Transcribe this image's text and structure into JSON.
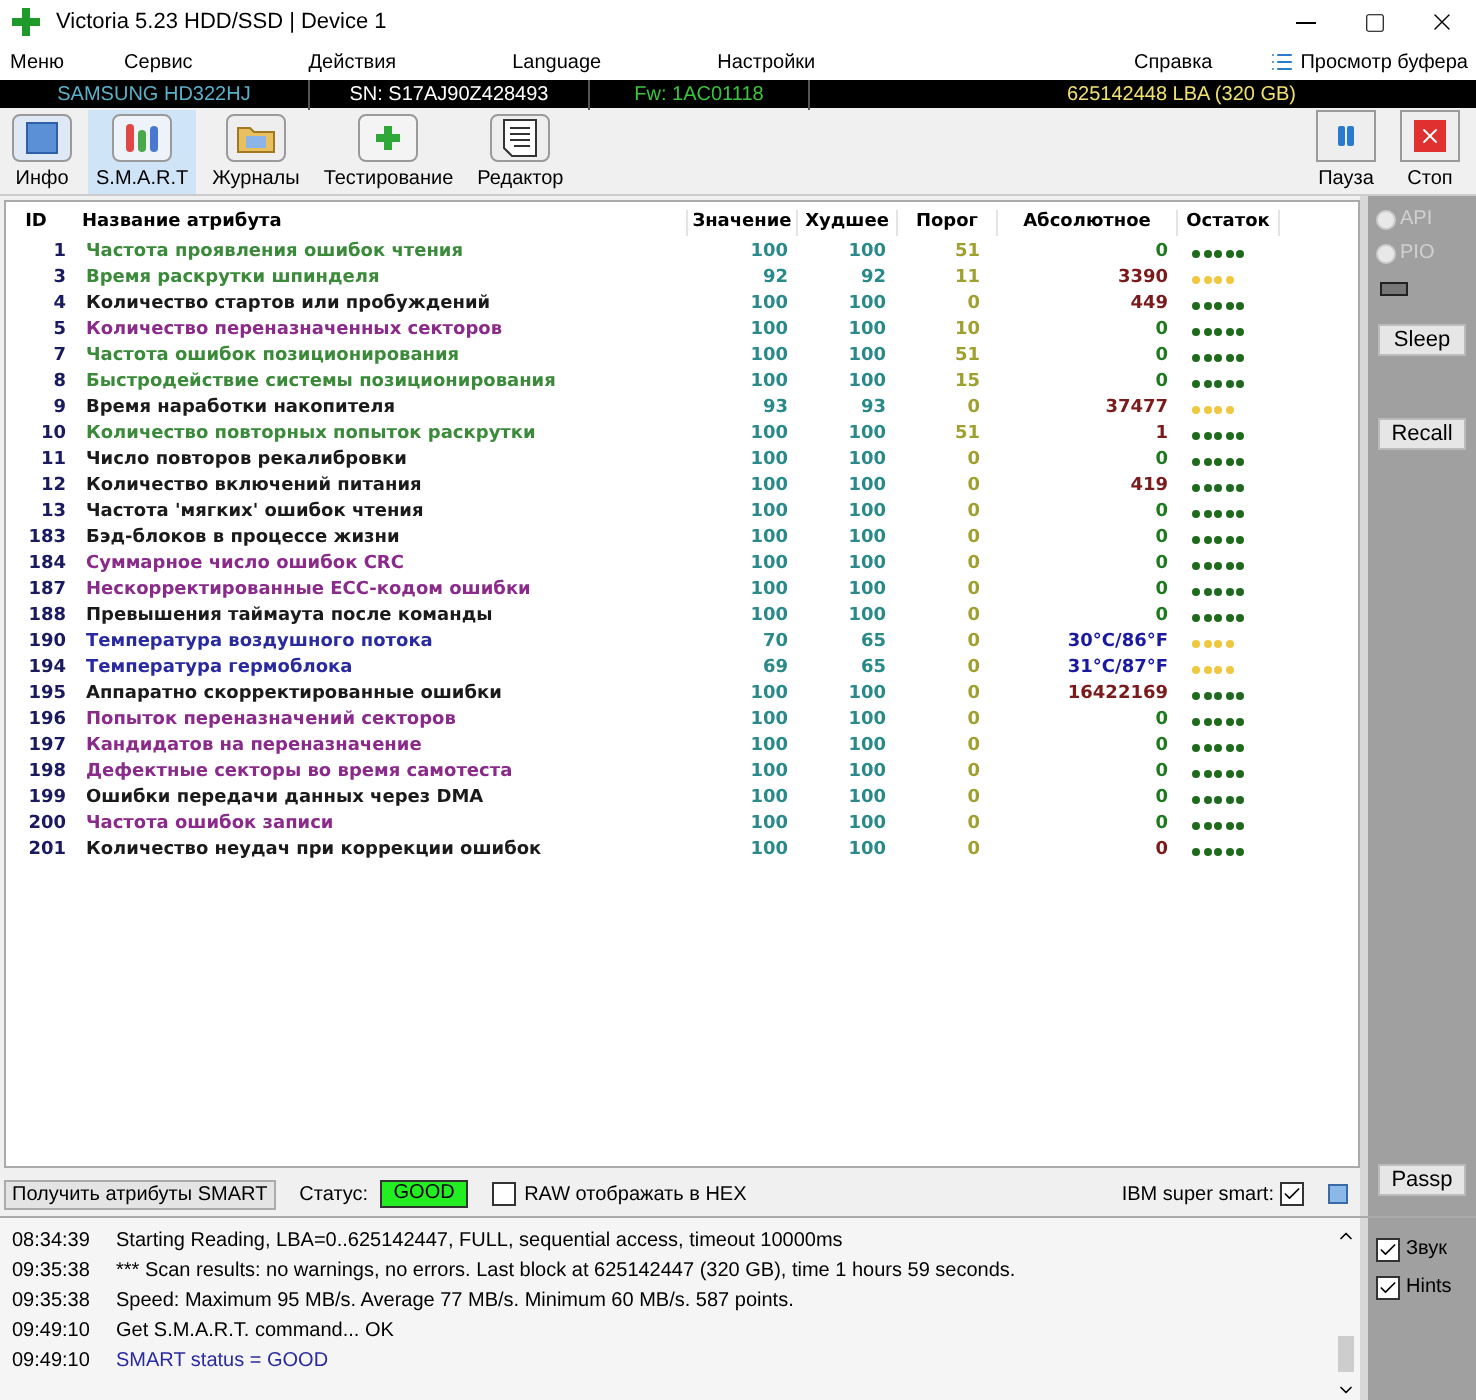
{
  "window": {
    "title": "Victoria 5.23 HDD/SSD | Device 1"
  },
  "menu": [
    "Меню",
    "Сервис",
    "Действия",
    "Language",
    "Настройки",
    "Справка"
  ],
  "buffer_button": "Просмотр буфера",
  "info_bar": {
    "model": "SAMSUNG HD322HJ",
    "serial": "SN: S17AJ90Z428493",
    "firmware": "Fw: 1AC01118",
    "capacity": "625142448 LBA (320 GB)"
  },
  "toolbar": [
    {
      "kind": "info",
      "label": "Инфо",
      "selected": false
    },
    {
      "kind": "smart",
      "label": "S.M.A.R.T",
      "selected": true
    },
    {
      "kind": "logs",
      "label": "Журналы",
      "selected": false
    },
    {
      "kind": "test",
      "label": "Тестирование",
      "selected": false
    },
    {
      "kind": "editor",
      "label": "Редактор",
      "selected": false
    }
  ],
  "toolbar_right": [
    {
      "kind": "pause",
      "label": "Пауза"
    },
    {
      "kind": "stop",
      "label": "Стоп"
    }
  ],
  "table": {
    "columns": [
      "ID",
      "Название атрибута",
      "Значение",
      "Худшее",
      "Порог",
      "Абсолютное",
      "Остаток"
    ],
    "rows": [
      {
        "id": "1",
        "name": "Частота проявления ошибок чтения",
        "color": "#3a8a3a",
        "value": "100",
        "worst": "100",
        "threshold": "51",
        "raw": "0",
        "kind": "zero",
        "stars": 5
      },
      {
        "id": "3",
        "name": "Время раскрутки шпинделя",
        "color": "#3a8a3a",
        "value": "92",
        "worst": "92",
        "threshold": "11",
        "raw": "3390",
        "kind": "count",
        "stars": 4
      },
      {
        "id": "4",
        "name": "Количество стартов или пробуждений",
        "color": "#1a1a1a",
        "value": "100",
        "worst": "100",
        "threshold": "0",
        "raw": "449",
        "kind": "count",
        "stars": 5
      },
      {
        "id": "5",
        "name": "Количество переназначенных секторов",
        "color": "#8a2a8a",
        "value": "100",
        "worst": "100",
        "threshold": "10",
        "raw": "0",
        "kind": "zero",
        "stars": 5
      },
      {
        "id": "7",
        "name": "Частота ошибок позиционирования",
        "color": "#3a8a3a",
        "value": "100",
        "worst": "100",
        "threshold": "51",
        "raw": "0",
        "kind": "zero",
        "stars": 5
      },
      {
        "id": "8",
        "name": "Быстродействие системы позиционирования",
        "color": "#3a8a3a",
        "value": "100",
        "worst": "100",
        "threshold": "15",
        "raw": "0",
        "kind": "zero",
        "stars": 5
      },
      {
        "id": "9",
        "name": "Время наработки накопителя",
        "color": "#1a1a1a",
        "value": "93",
        "worst": "93",
        "threshold": "0",
        "raw": "37477",
        "kind": "count",
        "stars": 4
      },
      {
        "id": "10",
        "name": "Количество повторных попыток раскрутки",
        "color": "#3a8a3a",
        "value": "100",
        "worst": "100",
        "threshold": "51",
        "raw": "1",
        "kind": "count",
        "stars": 5
      },
      {
        "id": "11",
        "name": "Число повторов рекалибровки",
        "color": "#1a1a1a",
        "value": "100",
        "worst": "100",
        "threshold": "0",
        "raw": "0",
        "kind": "zero",
        "stars": 5
      },
      {
        "id": "12",
        "name": "Количество включений питания",
        "color": "#1a1a1a",
        "value": "100",
        "worst": "100",
        "threshold": "0",
        "raw": "419",
        "kind": "count",
        "stars": 5
      },
      {
        "id": "13",
        "name": "Частота 'мягких' ошибок чтения",
        "color": "#1a1a1a",
        "value": "100",
        "worst": "100",
        "threshold": "0",
        "raw": "0",
        "kind": "zero",
        "stars": 5
      },
      {
        "id": "183",
        "name": "Бэд-блоков в процессе жизни",
        "color": "#1a1a1a",
        "value": "100",
        "worst": "100",
        "threshold": "0",
        "raw": "0",
        "kind": "zero",
        "stars": 5
      },
      {
        "id": "184",
        "name": "Суммарное число ошибок CRC",
        "color": "#8a2a8a",
        "value": "100",
        "worst": "100",
        "threshold": "0",
        "raw": "0",
        "kind": "zero",
        "stars": 5
      },
      {
        "id": "187",
        "name": "Нескорректированные ECC-кодом ошибки",
        "color": "#8a2a8a",
        "value": "100",
        "worst": "100",
        "threshold": "0",
        "raw": "0",
        "kind": "zero",
        "stars": 5
      },
      {
        "id": "188",
        "name": "Превышения таймаута после команды",
        "color": "#1a1a1a",
        "value": "100",
        "worst": "100",
        "threshold": "0",
        "raw": "0",
        "kind": "zero",
        "stars": 5
      },
      {
        "id": "190",
        "name": "Температура воздушного потока",
        "color": "#2a2aa0",
        "value": "70",
        "worst": "65",
        "threshold": "0",
        "raw": "30°C/86°F",
        "kind": "temperature",
        "stars": 4
      },
      {
        "id": "194",
        "name": "Температура гермоблока",
        "color": "#2a2aa0",
        "value": "69",
        "worst": "65",
        "threshold": "0",
        "raw": "31°C/87°F",
        "kind": "temperature",
        "stars": 4
      },
      {
        "id": "195",
        "name": "Аппаратно скорректированные ошибки",
        "color": "#1a1a1a",
        "value": "100",
        "worst": "100",
        "threshold": "0",
        "raw": "16422169",
        "kind": "count",
        "stars": 5
      },
      {
        "id": "196",
        "name": "Попыток переназначений секторов",
        "color": "#8a2a8a",
        "value": "100",
        "worst": "100",
        "threshold": "0",
        "raw": "0",
        "kind": "zero",
        "stars": 5
      },
      {
        "id": "197",
        "name": "Кандидатов на переназначение",
        "color": "#8a2a8a",
        "value": "100",
        "worst": "100",
        "threshold": "0",
        "raw": "0",
        "kind": "zero",
        "stars": 5
      },
      {
        "id": "198",
        "name": "Дефектные секторы во время самотеста",
        "color": "#8a2a8a",
        "value": "100",
        "worst": "100",
        "threshold": "0",
        "raw": "0",
        "kind": "zero",
        "stars": 5
      },
      {
        "id": "199",
        "name": "Ошибки передачи данных через DMA",
        "color": "#1a1a1a",
        "value": "100",
        "worst": "100",
        "threshold": "0",
        "raw": "0",
        "kind": "zero",
        "stars": 5
      },
      {
        "id": "200",
        "name": "Частота ошибок записи",
        "color": "#8a2a8a",
        "value": "100",
        "worst": "100",
        "threshold": "0",
        "raw": "0",
        "kind": "zero",
        "stars": 5
      },
      {
        "id": "201",
        "name": "Количество неудач при коррекции ошибок",
        "color": "#1a1a1a",
        "value": "100",
        "worst": "100",
        "threshold": "0",
        "raw": "0",
        "kind": "count",
        "stars": 5
      }
    ]
  },
  "side_panel": {
    "radios": [
      {
        "label": "API",
        "selected": false,
        "disabled": true
      },
      {
        "label": "PIO",
        "selected": false,
        "disabled": true
      }
    ],
    "buttons": [
      "Sleep",
      "Recall"
    ],
    "bottom_button": "Passp"
  },
  "status_bar": {
    "get_button": "Получить атрибуты SMART",
    "status_label": "Статус:",
    "status": "GOOD",
    "hex": {
      "label": "RAW отображать в HEX",
      "checked": false
    },
    "ibm": {
      "label": "IBM super smart:",
      "checked": true
    }
  },
  "log": [
    {
      "time": "08:34:39",
      "text": "Starting Reading, LBA=0..625142447, FULL, sequential access, timeout 10000ms",
      "kind": "normal"
    },
    {
      "time": "09:35:38",
      "text": "*** Scan results: no warnings, no errors. Last block at 625142447 (320 GB), time 1 hours 59 seconds.",
      "kind": "normal"
    },
    {
      "time": "09:35:38",
      "text": "Speed: Maximum 95 MB/s. Average 77 MB/s. Minimum 60 MB/s. 587 points.",
      "kind": "normal"
    },
    {
      "time": "09:49:10",
      "text": "Get S.M.A.R.T. command... OK",
      "kind": "normal"
    },
    {
      "time": "09:49:10",
      "text": "SMART status = GOOD",
      "kind": "highlight"
    }
  ],
  "log_options": [
    {
      "label": "Звук",
      "checked": true
    },
    {
      "label": "Hints",
      "checked": true
    }
  ]
}
